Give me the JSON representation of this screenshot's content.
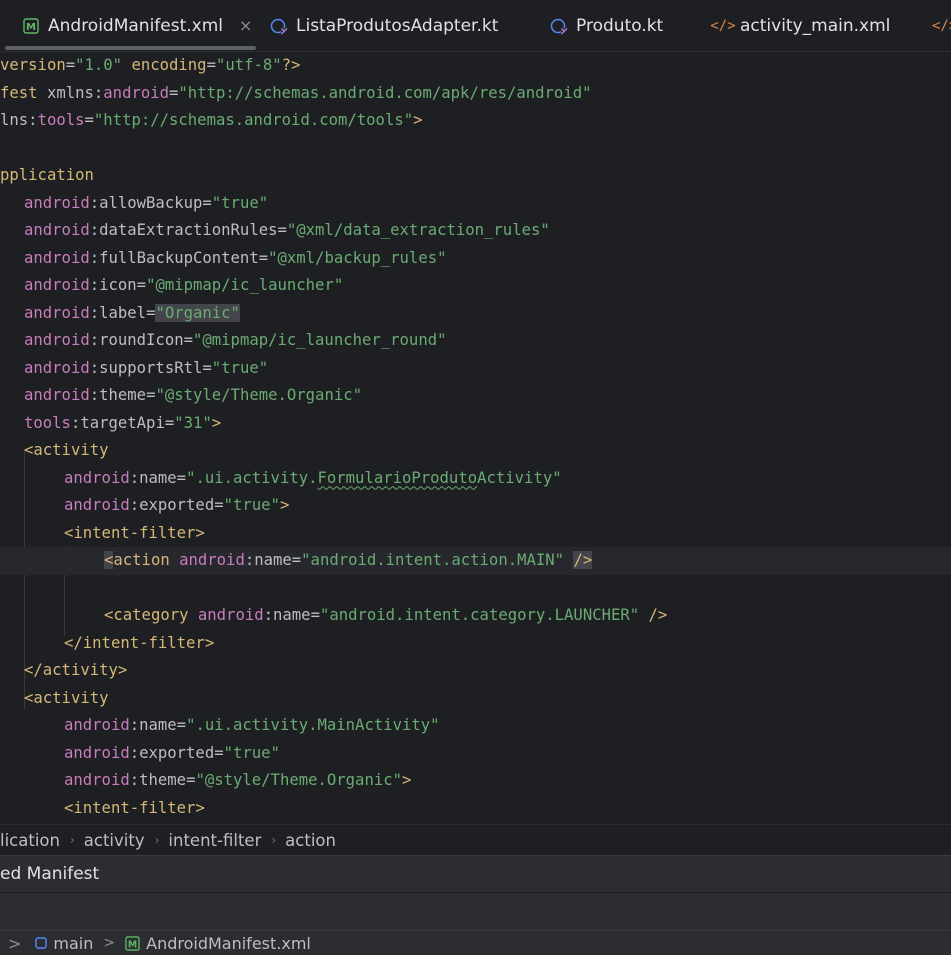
{
  "tabs": [
    {
      "label": "AndroidManifest.xml",
      "icon": "manifest-icon",
      "active": true,
      "close": "×"
    },
    {
      "label": "ListaProdutosAdapter.kt",
      "icon": "kotlin-class-icon"
    },
    {
      "label": "Produto.kt",
      "icon": "kotlin-class-icon"
    },
    {
      "label": "activity_main.xml",
      "icon": "xml-tag-icon"
    },
    {
      "label": "</>",
      "icon": "xml-tag-icon"
    }
  ],
  "code": {
    "l1": {
      "a": "version",
      "b": "=",
      "c": "\"1.0\"",
      "d": " encoding",
      "e": "=",
      "f": "\"utf-8\"",
      "g": "?>"
    },
    "l2": {
      "a": "fest ",
      "b": "xmlns:",
      "c": "android",
      "d": "=",
      "e": "\"http://schemas.android.com/apk/res/android\""
    },
    "l3": {
      "a": "lns:",
      "b": "tools",
      "c": "=",
      "d": "\"http://schemas.android.com/tools\"",
      "e": ">"
    },
    "l5": {
      "a": "pplication"
    },
    "l6": {
      "ns": "android",
      "attr": ":allowBackup",
      "eq": "=",
      "val": "\"true\""
    },
    "l7": {
      "ns": "android",
      "attr": ":dataExtractionRules",
      "eq": "=",
      "val": "\"@xml/data_extraction_rules\""
    },
    "l8": {
      "ns": "android",
      "attr": ":fullBackupContent",
      "eq": "=",
      "val": "\"@xml/backup_rules\""
    },
    "l9": {
      "ns": "android",
      "attr": ":icon",
      "eq": "=",
      "val": "\"@mipmap/ic_launcher\""
    },
    "l10": {
      "ns": "android",
      "attr": ":label",
      "eq": "=",
      "val": "\"Organic\""
    },
    "l11": {
      "ns": "android",
      "attr": ":roundIcon",
      "eq": "=",
      "val": "\"@mipmap/ic_launcher_round\""
    },
    "l12": {
      "ns": "android",
      "attr": ":supportsRtl",
      "eq": "=",
      "val": "\"true\""
    },
    "l13": {
      "ns": "android",
      "attr": ":theme",
      "eq": "=",
      "val": "\"@style/Theme.Organic\""
    },
    "l14": {
      "ns": "tools",
      "attr": ":targetApi",
      "eq": "=",
      "val": "\"31\"",
      "end": ">"
    },
    "l15": {
      "tag": "<activity"
    },
    "l16": {
      "ns": "android",
      "attr": ":name",
      "eq": "=",
      "v1": "\".ui.activity.",
      "v2": "FormularioProduto",
      "v3": "Activity\""
    },
    "l17": {
      "ns": "android",
      "attr": ":exported",
      "eq": "=",
      "val": "\"true\"",
      "end": ">"
    },
    "l18": {
      "tag": "<intent-filter>"
    },
    "l19": {
      "open": "<",
      "tag": "action ",
      "ns": "android",
      "attr": ":name",
      "eq": "=",
      "val": "\"android.intent.action.MAIN\"",
      "sp": " ",
      "end": "/>"
    },
    "l21": {
      "tag": "<category ",
      "ns": "android",
      "attr": ":name",
      "eq": "=",
      "val": "\"android.intent.category.LAUNCHER\"",
      "end": " />"
    },
    "l22": {
      "tag": "</intent-filter>"
    },
    "l23": {
      "tag": "</activity>"
    },
    "l24": {
      "tag": "<activity"
    },
    "l25": {
      "ns": "android",
      "attr": ":name",
      "eq": "=",
      "val": "\".ui.activity.MainActivity\""
    },
    "l26": {
      "ns": "android",
      "attr": ":exported",
      "eq": "=",
      "val": "\"true\""
    },
    "l27": {
      "ns": "android",
      "attr": ":theme",
      "eq": "=",
      "val": "\"@style/Theme.Organic\"",
      "end": ">"
    },
    "l28": {
      "tag": "<intent-filter>"
    }
  },
  "breadcrumb": [
    "lication",
    "activity",
    "intent-filter",
    "action"
  ],
  "merged_manifest": {
    "label": "ed Manifest"
  },
  "status": {
    "sep1": ">",
    "module": "main",
    "sep2": ">",
    "file": "AndroidManifest.xml"
  },
  "colors": {
    "background": "#1e1f22",
    "tag": "#d5b778",
    "namespace": "#c77dbb",
    "value": "#6aab73"
  }
}
